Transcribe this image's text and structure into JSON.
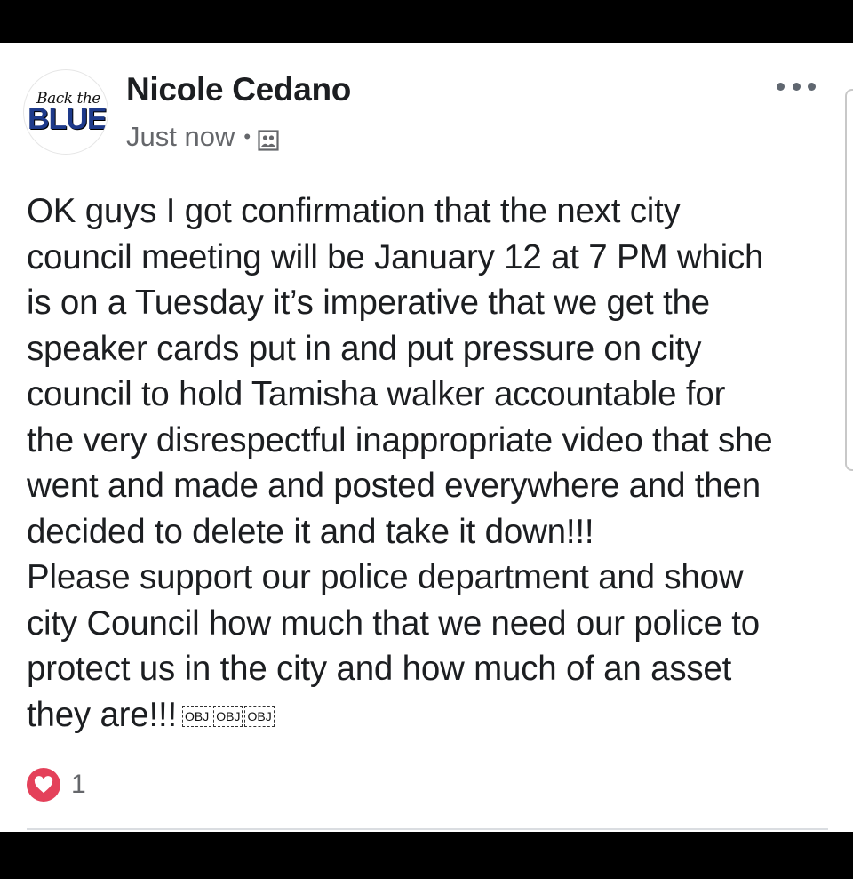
{
  "post": {
    "avatar": {
      "line1": "Back the",
      "line2": "BLUE"
    },
    "author": "Nicole Cedano",
    "timestamp": "Just now",
    "separator": "•",
    "audience_icon": "friends-icon",
    "more_icon": "more-options-icon",
    "lines": [
      "OK guys I got confirmation that the next city",
      "council meeting will be January 12 at 7 PM which",
      "is on a Tuesday it’s imperative that we get the",
      "speaker cards put in and put pressure on city",
      "council to hold Tamisha walker accountable for",
      "the very disrespectful inappropriate video that she",
      "went and made and posted everywhere and then",
      "decided to delete it and take it down!!!",
      "Please support our police department and show",
      "city Council how much that we need our police to",
      "protect us in the city and how much of an asset",
      "they are!!!"
    ],
    "placeholders": [
      "OBJ",
      "OBJ",
      "OBJ"
    ],
    "reactions": {
      "icon": "heart-reaction-icon",
      "count": "1"
    }
  },
  "colors": {
    "text": "#1c1e21",
    "secondary": "#65676b",
    "heart": "#e4415a",
    "frame": "#000000"
  }
}
